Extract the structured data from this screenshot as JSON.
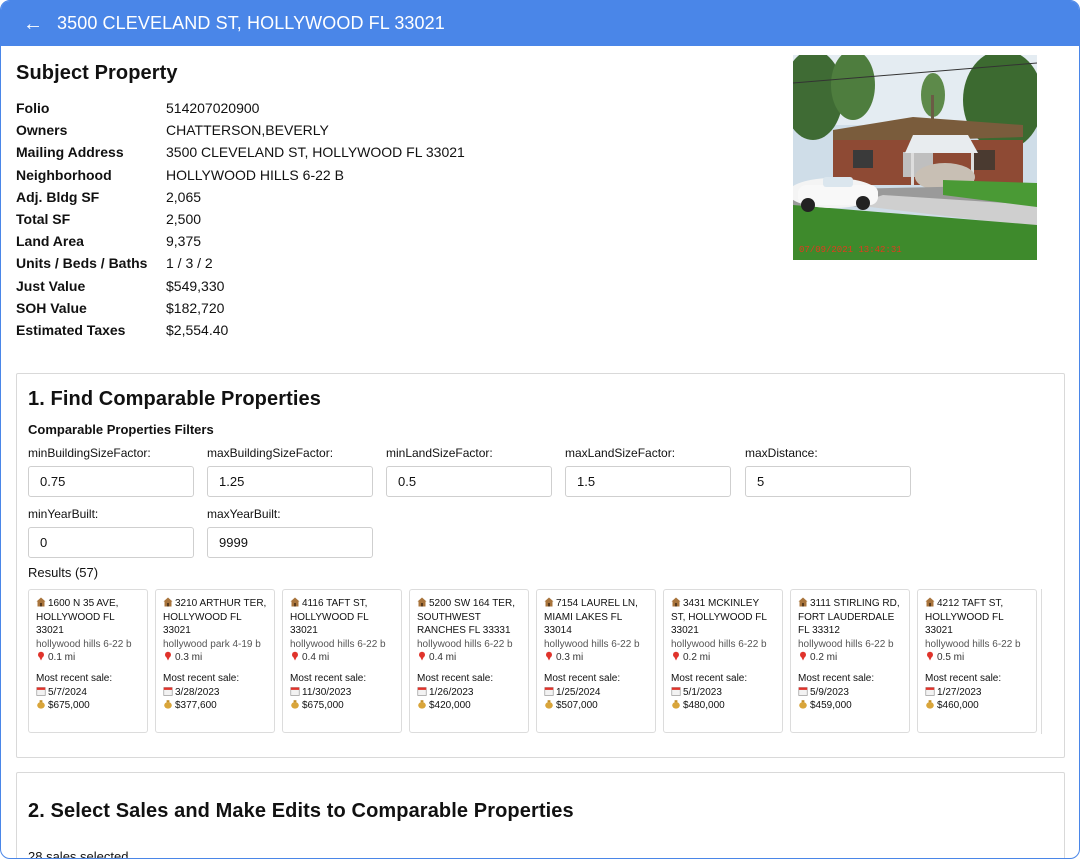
{
  "header": {
    "title": "3500 CLEVELAND ST, HOLLYWOOD FL 33021"
  },
  "subject": {
    "heading": "Subject Property",
    "rows": [
      {
        "label": "Folio",
        "value": "514207020900"
      },
      {
        "label": "Owners",
        "value": "CHATTERSON,BEVERLY"
      },
      {
        "label": "Mailing Address",
        "value": "3500 CLEVELAND ST, HOLLYWOOD FL 33021"
      },
      {
        "label": "Neighborhood",
        "value": "HOLLYWOOD HILLS 6-22 B"
      },
      {
        "label": "Adj. Bldg SF",
        "value": "2,065"
      },
      {
        "label": "Total SF",
        "value": "2,500"
      },
      {
        "label": "Land Area",
        "value": "9,375"
      },
      {
        "label": "Units / Beds / Baths",
        "value": "1 / 3 / 2"
      },
      {
        "label": "Just Value",
        "value": "$549,330"
      },
      {
        "label": "SOH Value",
        "value": "$182,720"
      },
      {
        "label": "Estimated Taxes",
        "value": "$2,554.40"
      }
    ],
    "photo_stamp": "07/09/2021 13:42:31"
  },
  "find": {
    "heading": "1. Find Comparable Properties",
    "subheading": "Comparable Properties Filters",
    "filters": [
      {
        "label": "minBuildingSizeFactor:",
        "value": "0.75"
      },
      {
        "label": "maxBuildingSizeFactor:",
        "value": "1.25"
      },
      {
        "label": "minLandSizeFactor:",
        "value": "0.5"
      },
      {
        "label": "maxLandSizeFactor:",
        "value": "1.5"
      },
      {
        "label": "maxDistance:",
        "value": "5"
      },
      {
        "label": "minYearBuilt:",
        "value": "0"
      },
      {
        "label": "maxYearBuilt:",
        "value": "9999"
      }
    ],
    "results_label": "Results (57)",
    "recent_label": "Most recent sale:",
    "results": [
      {
        "address": "1600 N 35 AVE, HOLLYWOOD FL 33021",
        "neighborhood": "hollywood hills 6-22 b",
        "distance": "0.1 mi",
        "date": "5/7/2024",
        "price": "$675,000"
      },
      {
        "address": "3210 ARTHUR TER, HOLLYWOOD FL 33021",
        "neighborhood": "hollywood park 4-19 b",
        "distance": "0.3 mi",
        "date": "3/28/2023",
        "price": "$377,600"
      },
      {
        "address": "4116 TAFT ST, HOLLYWOOD FL 33021",
        "neighborhood": "hollywood hills 6-22 b",
        "distance": "0.4 mi",
        "date": "11/30/2023",
        "price": "$675,000"
      },
      {
        "address": "5200 SW 164 TER, SOUTHWEST RANCHES FL 33331",
        "neighborhood": "hollywood hills 6-22 b",
        "distance": "0.4 mi",
        "date": "1/26/2023",
        "price": "$420,000"
      },
      {
        "address": "7154 LAUREL LN, MIAMI LAKES FL 33014",
        "neighborhood": "hollywood hills 6-22 b",
        "distance": "0.3 mi",
        "date": "1/25/2024",
        "price": "$507,000"
      },
      {
        "address": "3431 MCKINLEY ST, HOLLYWOOD FL 33021",
        "neighborhood": "hollywood hills 6-22 b",
        "distance": "0.2 mi",
        "date": "5/1/2023",
        "price": "$480,000"
      },
      {
        "address": "3111 STIRLING RD, FORT LAUDERDALE FL 33312",
        "neighborhood": "hollywood hills 6-22 b",
        "distance": "0.2 mi",
        "date": "5/9/2023",
        "price": "$459,000"
      },
      {
        "address": "4212 TAFT ST, HOLLYWOOD FL 33021",
        "neighborhood": "hollywood hills 6-22 b",
        "distance": "0.5 mi",
        "date": "1/27/2023",
        "price": "$460,000"
      }
    ]
  },
  "select": {
    "heading": "2. Select Sales and Make Edits to Comparable Properties",
    "selected_label": "28 sales selected"
  }
}
